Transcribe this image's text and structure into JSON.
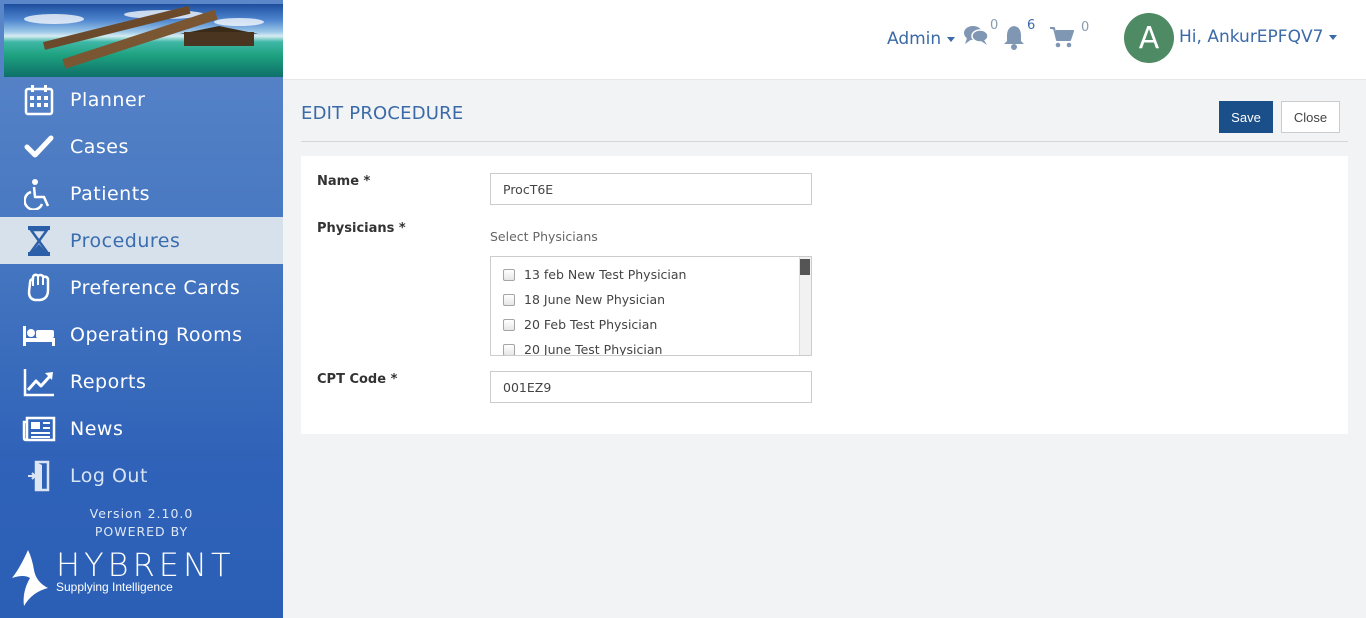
{
  "sidebar": {
    "items": [
      {
        "label": "Planner",
        "icon": "calendar-icon"
      },
      {
        "label": "Cases",
        "icon": "check-icon"
      },
      {
        "label": "Patients",
        "icon": "wheelchair-icon"
      },
      {
        "label": "Procedures",
        "icon": "hourglass-icon",
        "active": true
      },
      {
        "label": "Preference Cards",
        "icon": "hand-icon"
      },
      {
        "label": "Operating Rooms",
        "icon": "bed-icon"
      },
      {
        "label": "Reports",
        "icon": "line-chart-icon"
      },
      {
        "label": "News",
        "icon": "newspaper-icon"
      },
      {
        "label": "Log Out",
        "icon": "sign-out-icon"
      }
    ],
    "version": "Version 2.10.0",
    "powered_by": "POWERED BY",
    "brand_name": "HYBRENT",
    "brand_tagline": "Supplying Intelligence"
  },
  "topbar": {
    "admin_label": "Admin",
    "messages_count": "0",
    "notifications_count": "6",
    "cart_count": "0",
    "avatar_initial": "A",
    "greeting": "Hi, AnkurEPFQV7"
  },
  "page": {
    "title": "EDIT PROCEDURE",
    "save_label": "Save",
    "close_label": "Close"
  },
  "form": {
    "name_label": "Name *",
    "name_value": "ProcT6E",
    "physicians_label": "Physicians *",
    "physicians_hint": "Select Physicians",
    "physicians": [
      "13 feb New Test Physician",
      "18 June New Physician",
      "20 Feb Test Physician",
      "20 June Test Physician"
    ],
    "cpt_label": "CPT Code *",
    "cpt_value": "001EZ9"
  },
  "colors": {
    "accent": "#3a6aa8",
    "primary_button": "#1b4f8a",
    "sidebar": "#4677c1",
    "avatar": "#4e8a63"
  }
}
